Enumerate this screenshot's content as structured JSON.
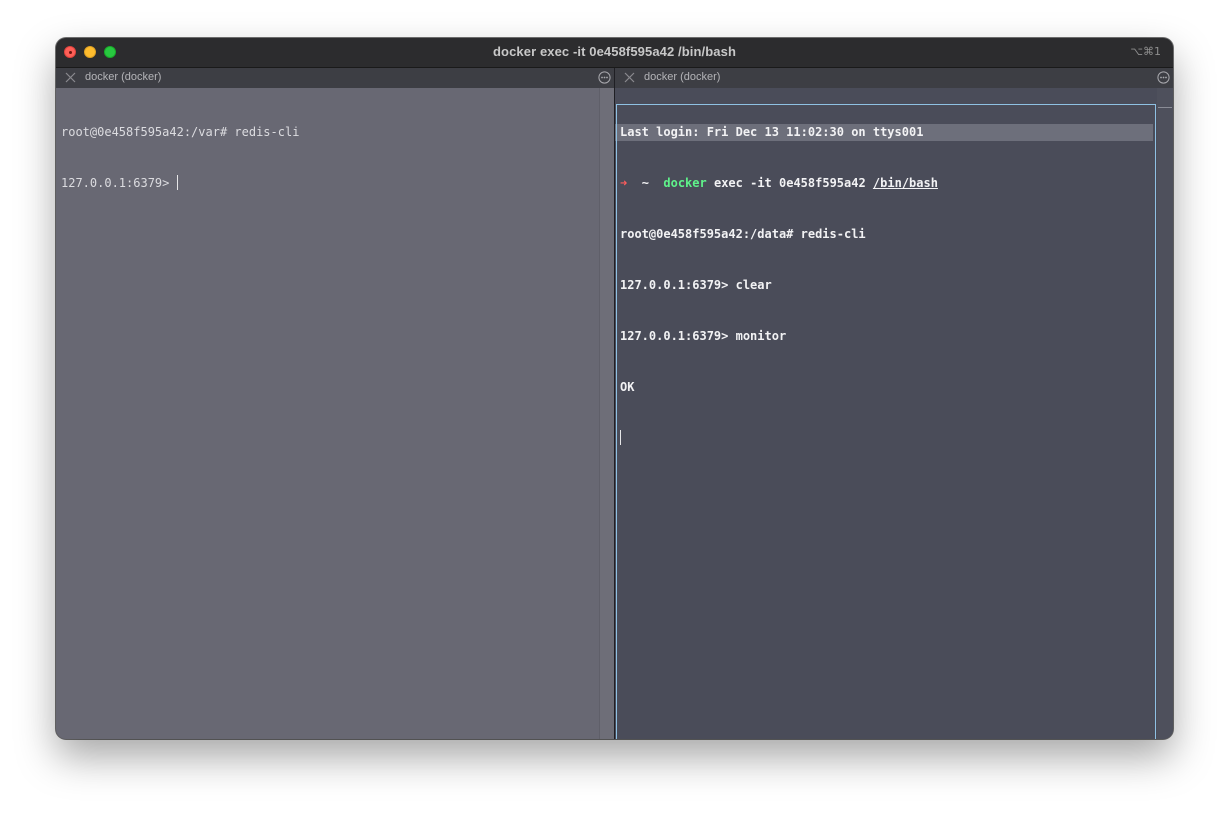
{
  "window": {
    "title": "docker exec -it 0e458f595a42 /bin/bash",
    "shortcut": "⌥⌘1"
  },
  "tabs": [
    {
      "label": "docker (docker)"
    },
    {
      "label": "docker (docker)"
    }
  ],
  "left_pane": {
    "lines": [
      "root@0e458f595a42:/var# redis-cli",
      "127.0.0.1:6379> "
    ]
  },
  "right_pane": {
    "login": "Last login: Fri Dec 13 11:02:30 on ttys001",
    "prompt_arrow": "➜",
    "prompt_dir": "~",
    "cmd_name": "docker",
    "cmd_args": "exec -it 0e458f595a42",
    "cmd_path": "/bin/bash",
    "lines": [
      "root@0e458f595a42:/data# redis-cli",
      "127.0.0.1:6379> clear",
      "127.0.0.1:6379> monitor",
      "OK"
    ]
  },
  "colors": {
    "left_bg": "#686873",
    "right_bg": "#4a4c59",
    "focus_border": "#8fc1e3",
    "prompt_arrow": "#ff5c5c",
    "command_green": "#5ff28a"
  },
  "icons": {
    "tab_close": "close-icon",
    "tab_menu": "ellipsis-circle-icon"
  }
}
